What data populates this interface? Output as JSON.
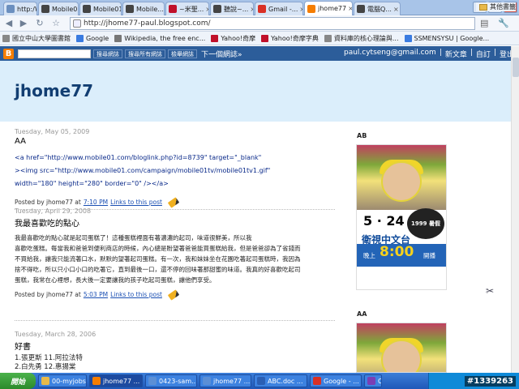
{
  "browser": {
    "tabs": [
      {
        "label": "http:/W...",
        "icon": "page-icon",
        "color": "#6b8fbf"
      },
      {
        "label": "Mobile01",
        "icon": "mobile01-icon",
        "color": "#444"
      },
      {
        "label": "Mobile01",
        "icon": "mobile01-icon",
        "color": "#444"
      },
      {
        "label": "Mobile...",
        "icon": "mobile01-icon",
        "color": "#444"
      },
      {
        "label": "~米聖...",
        "icon": "yahoo-icon",
        "color": "#c0102a"
      },
      {
        "label": "聽說~...",
        "icon": "mobile01-icon",
        "color": "#444"
      },
      {
        "label": "Gmail -...",
        "icon": "gmail-icon",
        "color": "#d93025"
      },
      {
        "label": "jhome77",
        "icon": "blogger-icon",
        "color": "#f57d00"
      },
      {
        "label": "電腦Q...",
        "icon": "mobile01-icon",
        "color": "#444"
      }
    ],
    "active_tab": 7,
    "url": "http://jhome77-paul.blogspot.com/",
    "bookmarks": [
      {
        "label": "國立中山大學圖書館",
        "icon": "page-icon",
        "color": "#888"
      },
      {
        "label": "Google",
        "icon": "google-icon",
        "color": "#3a7be0"
      },
      {
        "label": "Wikipedia, the free enc...",
        "icon": "wikipedia-icon",
        "color": "#777"
      },
      {
        "label": "Yahoo!奇摩",
        "icon": "yahoo-icon",
        "color": "#c0102a"
      },
      {
        "label": "Yahoo!奇摩字典",
        "icon": "yahoo-icon",
        "color": "#c0102a"
      },
      {
        "label": "資料庫的核心理論與...",
        "icon": "page-icon",
        "color": "#888"
      },
      {
        "label": "SSMENSYSU | Google...",
        "icon": "google-icon",
        "color": "#3a7be0"
      }
    ],
    "other_bookmarks": "其他書籤"
  },
  "navbar": {
    "search_btn": "搜尋網誌",
    "search_all_btn": "搜尋所有網誌",
    "flag_btn": "檢舉網誌",
    "next_blog": "下一個網誌»",
    "email": "paul.cytseng@gmail.com",
    "new_post": "新文章",
    "customize": "自訂",
    "sign_out": "登出",
    "sep": "|"
  },
  "blog": {
    "title": "jhome77"
  },
  "posts": [
    {
      "date": "Tuesday, May 05, 2009",
      "title": "AA",
      "body_lines": [
        "<a href=\"http://www.mobile01.com/bloglink.php?id=8739\" target=\"_blank\"",
        "><img src=\"http://www.mobile01.com/campaign/mobile01tv/mobile01tv1.gif\"",
        "width=\"180\" height=\"280\" border=\"0\" /></a>"
      ],
      "footer_prefix": "Posted by jhome77 at",
      "time": "7:10 PM",
      "links_label": "Links to this post"
    },
    {
      "date": "Tuesday, April 29, 2008",
      "title": "我最喜歡吃的點心",
      "body_lines": [
        "我最喜歡吃的點心就是起司蛋糕了！這種蛋糕裡面有著濃濃的起司，味道很鮮美，所以我",
        "喜歡吃蛋糕。每當我和爸爸到便利商店的時候，內心總是盼望著爸爸能買蛋糕給我，但是爸爸卻為了省錢而",
        "不買給我，讓我只能流著口水，默默的望著起司蛋糕。有一次，我和妹妹坐在花園吃著起司蛋糕時，我因為",
        "捨不得吃，所以只小口小口的吃著它，直到最後一口，還不停的回味著那甜蜜的味道。我真的好喜歡吃起司",
        "蛋糕，我常在心裡想，長大後一定要讓我的孩子吃起司蛋糕，讓他們享受。"
      ],
      "footer_prefix": "Posted by jhome77 at",
      "time": "5:03 PM",
      "links_label": "Links to this post"
    },
    {
      "date": "Tuesday, March 28, 2006",
      "title": "好書",
      "list_lines": [
        "1.張更斯 11.阿拉法特",
        "2.白先勇 12.惠揚棠"
      ]
    }
  ],
  "sidebar": {
    "head1": "AB",
    "head2": "AA",
    "poster": {
      "badge": "1999 暑假",
      "date": "5 · 24",
      "channel": "衛視中文台",
      "time_prefix": "晚上",
      "time": "8:00",
      "time_suffix": "開播"
    }
  },
  "taskbar": {
    "start": "開始",
    "items": [
      {
        "label": "00-myjobs",
        "color": "#e8b94a"
      },
      {
        "label": "jhome77 ...",
        "color": "#f57d00"
      },
      {
        "label": "0423-sam...",
        "color": "#5b8fd6"
      },
      {
        "label": "jhome77 ...",
        "color": "#5b8fd6"
      },
      {
        "label": "ABC.doc ...",
        "color": "#2b5fb4"
      },
      {
        "label": "Google - ...",
        "color": "#d93025"
      },
      {
        "label": "C#",
        "color": "#7a3fb4"
      }
    ],
    "watermark": "#1339263"
  }
}
